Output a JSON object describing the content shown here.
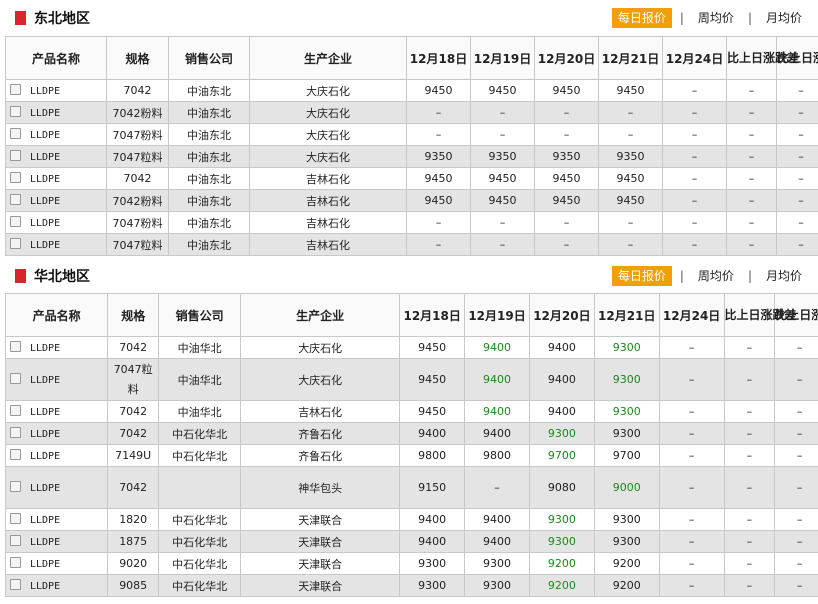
{
  "sections": [
    {
      "title": "东北地区",
      "tabs": [
        "每日报价",
        "周均价",
        "月均价"
      ],
      "headers": [
        "产品名称",
        "规格",
        "销售公司",
        "生产企业",
        "12月18日",
        "12月19日",
        "12月20日",
        "12月21日",
        "12月24日",
        "比上日涨跌差",
        "比上日涨跌率"
      ],
      "rows": [
        {
          "product": "LLDPE",
          "spec": "7042",
          "seller": "中油东北",
          "producer": "大庆石化",
          "d18": "9450",
          "d19": "9450",
          "d20": "9450",
          "d21": "9450",
          "d24": "–",
          "diff": "–",
          "rate": "–"
        },
        {
          "product": "LLDPE",
          "spec": "7042粉料",
          "seller": "中油东北",
          "producer": "大庆石化",
          "d18": "–",
          "d19": "–",
          "d20": "–",
          "d21": "–",
          "d24": "–",
          "diff": "–",
          "rate": "–"
        },
        {
          "product": "LLDPE",
          "spec": "7047粉料",
          "seller": "中油东北",
          "producer": "大庆石化",
          "d18": "–",
          "d19": "–",
          "d20": "–",
          "d21": "–",
          "d24": "–",
          "diff": "–",
          "rate": "–"
        },
        {
          "product": "LLDPE",
          "spec": "7047粒料",
          "seller": "中油东北",
          "producer": "大庆石化",
          "d18": "9350",
          "d19": "9350",
          "d20": "9350",
          "d21": "9350",
          "d24": "–",
          "diff": "–",
          "rate": "–"
        },
        {
          "product": "LLDPE",
          "spec": "7042",
          "seller": "中油东北",
          "producer": "吉林石化",
          "d18": "9450",
          "d19": "9450",
          "d20": "9450",
          "d21": "9450",
          "d24": "–",
          "diff": "–",
          "rate": "–"
        },
        {
          "product": "LLDPE",
          "spec": "7042粉料",
          "seller": "中油东北",
          "producer": "吉林石化",
          "d18": "9450",
          "d19": "9450",
          "d20": "9450",
          "d21": "9450",
          "d24": "–",
          "diff": "–",
          "rate": "–"
        },
        {
          "product": "LLDPE",
          "spec": "7047粉料",
          "seller": "中油东北",
          "producer": "吉林石化",
          "d18": "–",
          "d19": "–",
          "d20": "–",
          "d21": "–",
          "d24": "–",
          "diff": "–",
          "rate": "–"
        },
        {
          "product": "LLDPE",
          "spec": "7047粒料",
          "seller": "中油东北",
          "producer": "吉林石化",
          "d18": "–",
          "d19": "–",
          "d20": "–",
          "d21": "–",
          "d24": "–",
          "diff": "–",
          "rate": "–"
        }
      ]
    },
    {
      "title": "华北地区",
      "tabs": [
        "每日报价",
        "周均价",
        "月均价"
      ],
      "headers": [
        "产品名称",
        "规格",
        "销售公司",
        "生产企业",
        "12月18日",
        "12月19日",
        "12月20日",
        "12月21日",
        "12月24日",
        "比上日涨跌差",
        "比上日涨跌率"
      ],
      "rows": [
        {
          "product": "LLDPE",
          "spec": "7042",
          "seller": "中油华北",
          "producer": "大庆石化",
          "d18": "9450",
          "d19": "9400",
          "d20": "9400",
          "d21": "9300",
          "d24": "–",
          "diff": "–",
          "rate": "–"
        },
        {
          "product": "LLDPE",
          "spec": "7047粒料",
          "seller": "中油华北",
          "producer": "大庆石化",
          "d18": "9450",
          "d19": "9400",
          "d20": "9400",
          "d21": "9300",
          "d24": "–",
          "diff": "–",
          "rate": "–"
        },
        {
          "product": "LLDPE",
          "spec": "7042",
          "seller": "中油华北",
          "producer": "吉林石化",
          "d18": "9450",
          "d19": "9400",
          "d20": "9400",
          "d21": "9300",
          "d24": "–",
          "diff": "–",
          "rate": "–"
        },
        {
          "product": "LLDPE",
          "spec": "7042",
          "seller": "中石化华北",
          "producer": "齐鲁石化",
          "d18": "9400",
          "d19": "9400",
          "d20": "9300",
          "d21": "9300",
          "d24": "–",
          "diff": "–",
          "rate": "–"
        },
        {
          "product": "LLDPE",
          "spec": "7149U",
          "seller": "中石化华北",
          "producer": "齐鲁石化",
          "d18": "9800",
          "d19": "9800",
          "d20": "9700",
          "d21": "9700",
          "d24": "–",
          "diff": "–",
          "rate": "–"
        },
        {
          "product": "LLDPE",
          "spec": "7042",
          "seller": "",
          "producer": "神华包头",
          "d18": "9150",
          "d19": "–",
          "d20": "9080",
          "d21": "9000",
          "d24": "–",
          "diff": "–",
          "rate": "–"
        },
        {
          "product": "LLDPE",
          "spec": "1820",
          "seller": "中石化华北",
          "producer": "天津联合",
          "d18": "9400",
          "d19": "9400",
          "d20": "9300",
          "d21": "9300",
          "d24": "–",
          "diff": "–",
          "rate": "–"
        },
        {
          "product": "LLDPE",
          "spec": "1875",
          "seller": "中石化华北",
          "producer": "天津联合",
          "d18": "9400",
          "d19": "9400",
          "d20": "9300",
          "d21": "9300",
          "d24": "–",
          "diff": "–",
          "rate": "–"
        },
        {
          "product": "LLDPE",
          "spec": "9020",
          "seller": "中石化华北",
          "producer": "天津联合",
          "d18": "9300",
          "d19": "9300",
          "d20": "9200",
          "d21": "9200",
          "d24": "–",
          "diff": "–",
          "rate": "–"
        },
        {
          "product": "LLDPE",
          "spec": "9085",
          "seller": "中石化华北",
          "producer": "天津联合",
          "d18": "9300",
          "d19": "9300",
          "d20": "9200",
          "d21": "9200",
          "d24": "–",
          "diff": "–",
          "rate": "–"
        }
      ]
    }
  ],
  "colors": {
    "accent": "#f29f05",
    "section_mark": "#d8262d",
    "price_change": "#1a8a1a",
    "alt_row": "#e4e4e4"
  }
}
